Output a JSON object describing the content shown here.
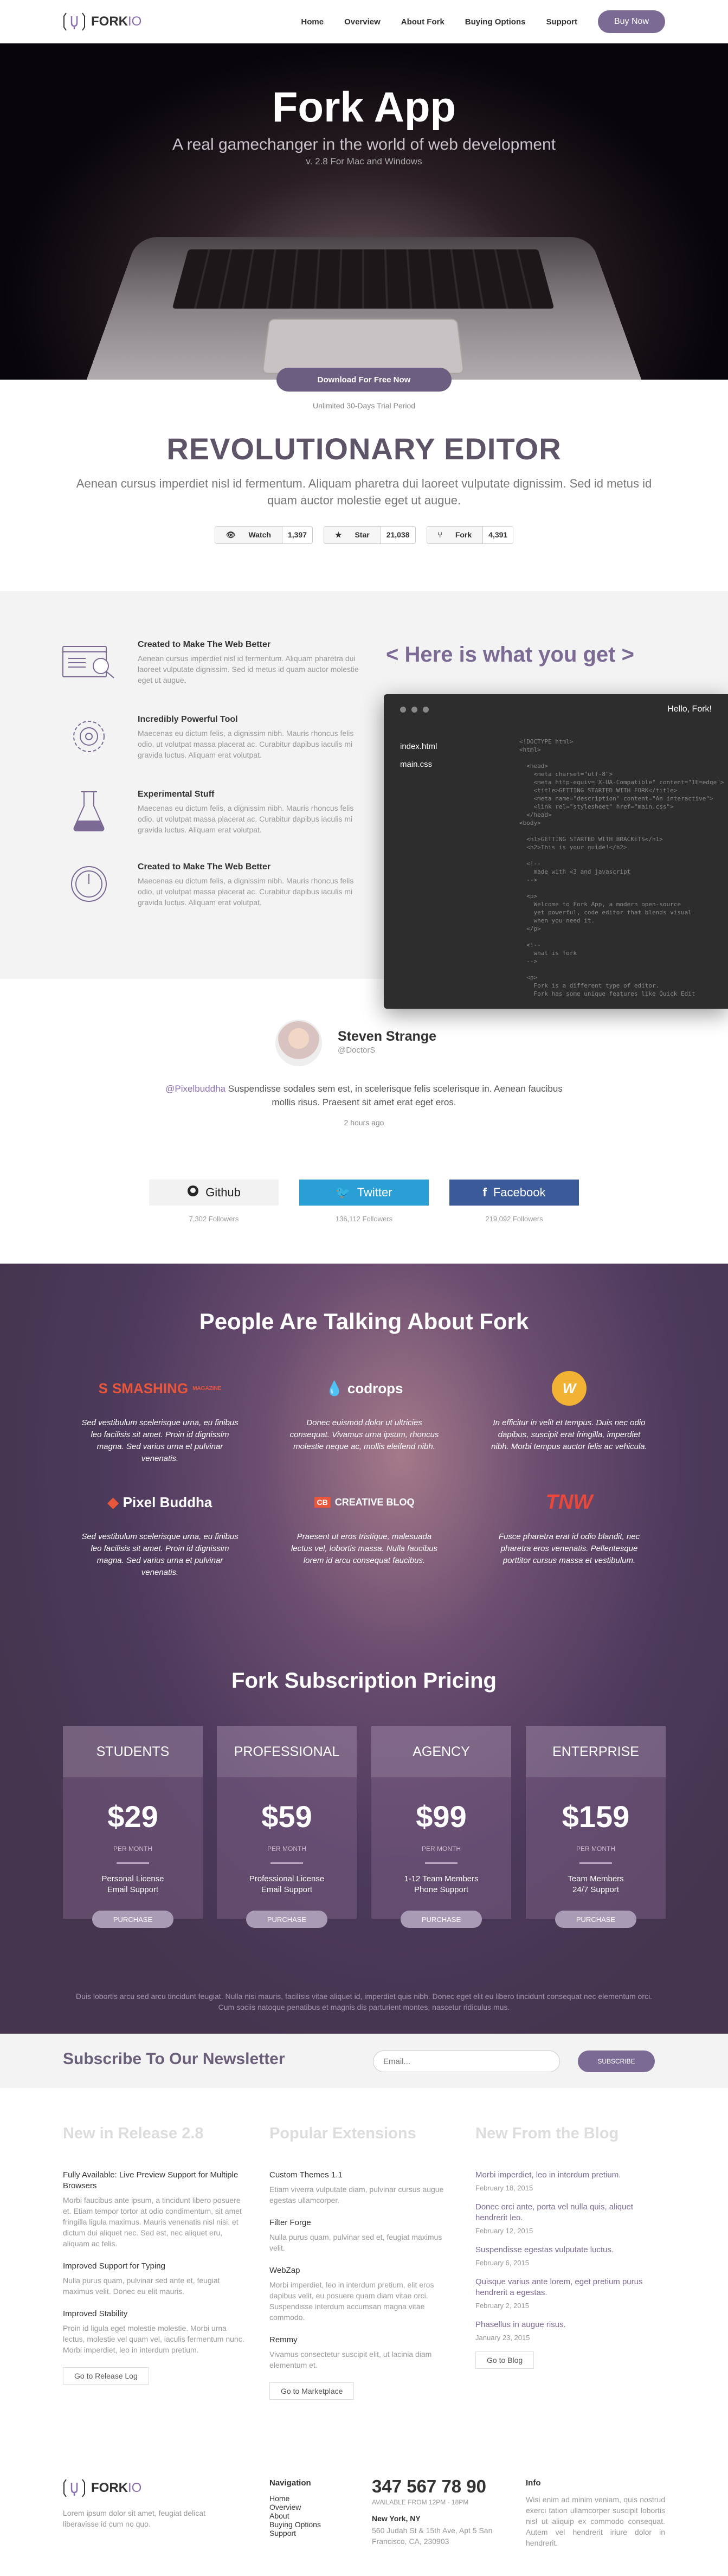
{
  "nav": {
    "logo_bold": "FORK",
    "logo_light": "IO",
    "items": [
      "Home",
      "Overview",
      "About Fork",
      "Buying Options",
      "Support"
    ],
    "buy_label": "Buy Now"
  },
  "hero": {
    "title": "Fork App",
    "subtitle": "A real gamechanger in the world of web development",
    "version": "v. 2.8 For Mac and Windows"
  },
  "download": {
    "button": "Download For Free Now",
    "trial": "Unlimited 30-Days Trial Period"
  },
  "editor": {
    "title": "REVOLUTIONARY EDITOR",
    "desc": "Aenean cursus imperdiet nisl id fermentum. Aliquam pharetra dui laoreet vulputate dignissim. Sed id metus id quam auctor molestie eget ut augue.",
    "github": [
      {
        "label": "Watch",
        "count": "1,397",
        "icon": "eye-icon"
      },
      {
        "label": "Star",
        "count": "21,038",
        "icon": "star-icon"
      },
      {
        "label": "Fork",
        "count": "4,391",
        "icon": "fork-icon"
      }
    ]
  },
  "features": {
    "title": "< Here is what you get >",
    "items": [
      {
        "title": "Created to Make The Web Better",
        "text": "Aenean cursus imperdiet nisl id fermentum. Aliquam pharetra dui laoreet vulputate dignissim. Sed id metus id quam auctor molestie eget ut augue.",
        "icon": "browser-search-icon"
      },
      {
        "title": "Incredibly Powerful Tool",
        "text": "Maecenas eu dictum felis, a dignissim nibh. Mauris rhoncus felis odio, ut volutpat massa placerat ac. Curabitur dapibus iaculis mi gravida luctus. Aliquam erat volutpat.",
        "icon": "gear-icon"
      },
      {
        "title": "Experimental Stuff",
        "text": "Maecenas eu dictum felis, a dignissim nibh. Mauris rhoncus felis odio, ut volutpat massa placerat ac. Curabitur dapibus iaculis mi gravida luctus. Aliquam erat volutpat.",
        "icon": "flask-icon"
      },
      {
        "title": "Created to Make The Web Better",
        "text": "Maecenas eu dictum felis, a dignissim nibh. Mauris rhoncus felis odio, ut volutpat massa placerat ac. Curabitur dapibus iaculis mi gravida luctus. Aliquam erat volutpat.",
        "icon": "clock-icon"
      }
    ]
  },
  "code_window": {
    "title": "Hello, Fork!",
    "files": [
      "index.html",
      "main.css"
    ],
    "code": "<!DOCTYPE html>\n<html>\n\n  <head>\n    <meta charset=\"utf-8\">\n    <meta http-equiv=\"X-UA-Compatible\" content=\"IE=edge\">\n    <title>GETTING STARTED WITH FORK</title>\n    <meta name=\"description\" content=\"An interactive\">\n    <link rel=\"stylesheet\" href=\"main.css\">\n  </head>\n<body>\n\n  <h1>GETTING STARTED WITH BRACKETS</h1>\n  <h2>This is your guide!</h2>\n\n  <!--\n    made with <3 and javascript\n  -->\n\n  <p>\n    Welcome to Fork App, a modern open-source\n    yet powerful, code editor that blends visual\n    when you need it.\n  </p>\n\n  <!--\n    what is fork\n  -->\n\n  <p>\n    Fork is a different type of editor.\n    Fork has some unique features like Quick Edit\n    editors. And Brackets is written in JavaScript\n    have the skills necessary to modify and extend\n  </p>"
  },
  "testimonial": {
    "name": "Steven Strange",
    "handle": "@DoctorS",
    "mention": "@Pixelbuddha",
    "text": " Suspendisse sodales sem est, in scelerisque felis scelerisque in. Aenean faucibus mollis risus. Praesent sit amet erat eget eros.",
    "time": "2 hours ago"
  },
  "social": [
    {
      "label": "Github",
      "followers": "7,302 Followers",
      "icon": "github-icon"
    },
    {
      "label": "Twitter",
      "followers": "136,112 Followers",
      "icon": "twitter-icon"
    },
    {
      "label": "Facebook",
      "followers": "219,092 Followers",
      "icon": "facebook-icon"
    }
  ],
  "talking": {
    "title": "People Are Talking About Fork",
    "brands": [
      {
        "name": "SMASHING",
        "sub": "MAGAZINE",
        "text": "Sed vestibulum scelerisque urna, eu finibus leo facilisis sit amet. Proin id dignissim magna. Sed varius urna et pulvinar venenatis.",
        "color": "#e8573c"
      },
      {
        "name": "codrops",
        "sub": "",
        "text": "Donec euismod dolor ut ultricies consequat. Vivamus urna ipsum, rhoncus molestie neque ac, mollis eleifend nibh.",
        "color": "#ffffff"
      },
      {
        "name": "W",
        "sub": "",
        "text": "In efficitur in velit et tempus. Duis nec odio dapibus, suscipit erat fringilla, imperdiet nibh. Morbi tempus auctor felis ac vehicula.",
        "color": "#f2b233"
      },
      {
        "name": "Pixel Buddha",
        "sub": "",
        "text": "Sed vestibulum scelerisque urna, eu finibus leo facilisis sit amet. Proin id dignissim magna. Sed varius urna et pulvinar venenatis.",
        "color": "#ffffff"
      },
      {
        "name": "CREATIVE BLOQ",
        "sub": "",
        "text": "Praesent ut eros tristique, malesuada lectus vel, lobortis massa. Nulla faucibus lorem id arcu consequat faucibus.",
        "color": "#ffffff"
      },
      {
        "name": "TNW",
        "sub": "",
        "text": "Fusce pharetra erat id odio blandit, nec pharetra eros venenatis. Pellentesque porttitor cursus massa et vestibulum.",
        "color": "#e8473c"
      }
    ]
  },
  "pricing": {
    "title": "Fork Subscription Pricing",
    "plans": [
      {
        "name": "STUDENTS",
        "price": "$29",
        "per": "PER MONTH",
        "f1": "Personal License",
        "f2": "Email Support",
        "button": "PURCHASE"
      },
      {
        "name": "PROFESSIONAL",
        "price": "$59",
        "per": "PER MONTH",
        "f1": "Professional License",
        "f2": "Email Support",
        "button": "PURCHASE"
      },
      {
        "name": "AGENCY",
        "price": "$99",
        "per": "PER MONTH",
        "f1": "1-12 Team Members",
        "f2": "Phone Support",
        "button": "PURCHASE"
      },
      {
        "name": "ENTERPRISE",
        "price": "$159",
        "per": "PER MONTH",
        "f1": "Team Members",
        "f2": "24/7 Support",
        "button": "PURCHASE"
      }
    ],
    "note": "Duis lobortis arcu sed arcu tincidunt feugiat. Nulla nisi mauris, facilisis vitae aliquet id, imperdiet quis nibh. Donec eget elit eu libero tincidunt consequat nec elementum orci. Cum sociis natoque penatibus et magnis dis parturient montes, nascetur ridiculus mus."
  },
  "newsletter": {
    "title": "Subscribe To Our Newsletter",
    "placeholder": "Email...",
    "button": "SUBSCRIBE"
  },
  "release": {
    "title": "New in Release 2.8",
    "items": [
      {
        "title": "Fully Available: Live Preview Support for Multiple Browsers",
        "text": "Morbi faucibus ante ipsum, a tincidunt libero posuere et. Etiam tempor tortor at odio condimentum, sit amet fringilla ligula maximus. Mauris venenatis nisl nisi, et dictum dui aliquet nec. Sed est, nec aliquet eru, aliquam ac felis."
      },
      {
        "title": "Improved Support for Typing",
        "text": "Nulla purus quam, pulvinar sed ante et, feugiat maximus velit. Donec eu elit mauris."
      },
      {
        "title": "Improved Stability",
        "text": "Proin id ligula eget molestie molestie. Morbi urna lectus, molestie vel quam vel, iaculis fermentum nunc. Morbi imperdiet, leo in interdum pretium."
      }
    ],
    "button": "Go to Release Log"
  },
  "extensions": {
    "title": "Popular Extensions",
    "items": [
      {
        "title": "Custom Themes 1.1",
        "text": "Etiam viverra vulputate diam, pulvinar cursus augue egestas ullamcorper."
      },
      {
        "title": "Filter Forge",
        "text": "Nulla purus quam, pulvinar sed et, feugiat maximus velit."
      },
      {
        "title": "WebZap",
        "text": "Morbi imperdiet, leo in interdum pretium, elit eros dapibus velit, eu posuere quam diam vitae orci. Suspendisse interdum accumsan magna vitae commodo."
      },
      {
        "title": "Remmy",
        "text": "Vivamus consectetur suscipit elit, ut lacinia diam elementum et."
      }
    ],
    "button": "Go to Marketplace"
  },
  "blog": {
    "title": "New From the Blog",
    "items": [
      {
        "title": "Morbi imperdiet, leo in interdum pretium.",
        "date": "February 18, 2015"
      },
      {
        "title": "Donec orci ante, porta vel nulla quis, aliquet hendrerit leo.",
        "date": "February 12, 2015"
      },
      {
        "title": "Suspendisse egestas vulputate luctus.",
        "date": "February 6, 2015"
      },
      {
        "title": "Quisque varius ante lorem, eget pretium purus hendrerit a egestas.",
        "date": "February 2, 2015"
      },
      {
        "title": "Phasellus in augue risus.",
        "date": "January 23, 2015"
      }
    ],
    "button": "Go to Blog"
  },
  "footer": {
    "about": "Lorem ipsum dolor sit amet, feugiat delicat liberavisse id cum no quo.",
    "nav_title": "Navigation",
    "nav_items": [
      "Home",
      "Overview",
      "About",
      "Buying Options",
      "Support"
    ],
    "phone": "347 567 78 90",
    "hours": "AVAILABLE FROM 12PM - 18PM",
    "city": "New York, NY",
    "address": "560 Judah St & 15th Ave, Apt 5 San Francisco, CA, 230903",
    "info_title": "Info",
    "info_text": "Wisi enim ad minim veniam, quis nostrud exerci tation ullamcorper suscipit lobortis nisl ut aliquip ex commodo consequat. Autem vel hendrerit iriure dolor in hendrerit."
  }
}
